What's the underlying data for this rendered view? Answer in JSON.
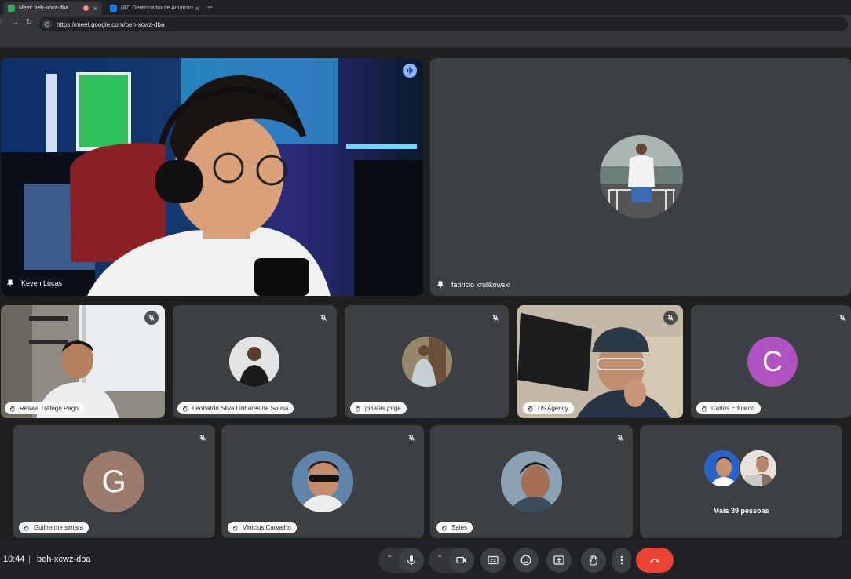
{
  "browser": {
    "tabs": [
      {
        "title": "Meet: beh-xcwz-dba",
        "active": true
      },
      {
        "title": "(87) Gerenciador de Anúncios",
        "active": false
      }
    ],
    "new_tab_label": "+",
    "close_glyph": "×",
    "url": "https://meet.google.com/beh-xcwz-dba"
  },
  "main_tiles": [
    {
      "name": "Keven Lucas",
      "speaking": true
    },
    {
      "name": "fabricio krulikowski",
      "speaking": false
    }
  ],
  "row2": [
    {
      "name": "Reswe Tráfego Pago",
      "muted": true,
      "kind": "video"
    },
    {
      "name": "Leonardo Silva Linhares de Sousa",
      "muted": true,
      "kind": "photo"
    },
    {
      "name": "jonatas jorge",
      "muted": true,
      "kind": "photo"
    },
    {
      "name": "D5 Agency",
      "muted": true,
      "kind": "video"
    },
    {
      "name": "Carlos Eduardo",
      "muted": true,
      "kind": "letter",
      "letter": "C",
      "color": "#b052c0"
    }
  ],
  "row3": [
    {
      "name": "Guilherme simara",
      "muted": true,
      "kind": "letter",
      "letter": "G",
      "color": "#9c7b6d"
    },
    {
      "name": "Vinicius Carvalho",
      "muted": true,
      "kind": "photo"
    },
    {
      "name": "Sales",
      "muted": true,
      "kind": "photo"
    }
  ],
  "more_people": "Mais 39 pessoas",
  "bottom_bar": {
    "time": "10:44",
    "separator": "|",
    "meeting_code": "beh-xcwz-dba"
  },
  "colors": {
    "accent": "#8ab4f8",
    "hangup": "#ea4335",
    "tile_bg": "#3c4043"
  }
}
